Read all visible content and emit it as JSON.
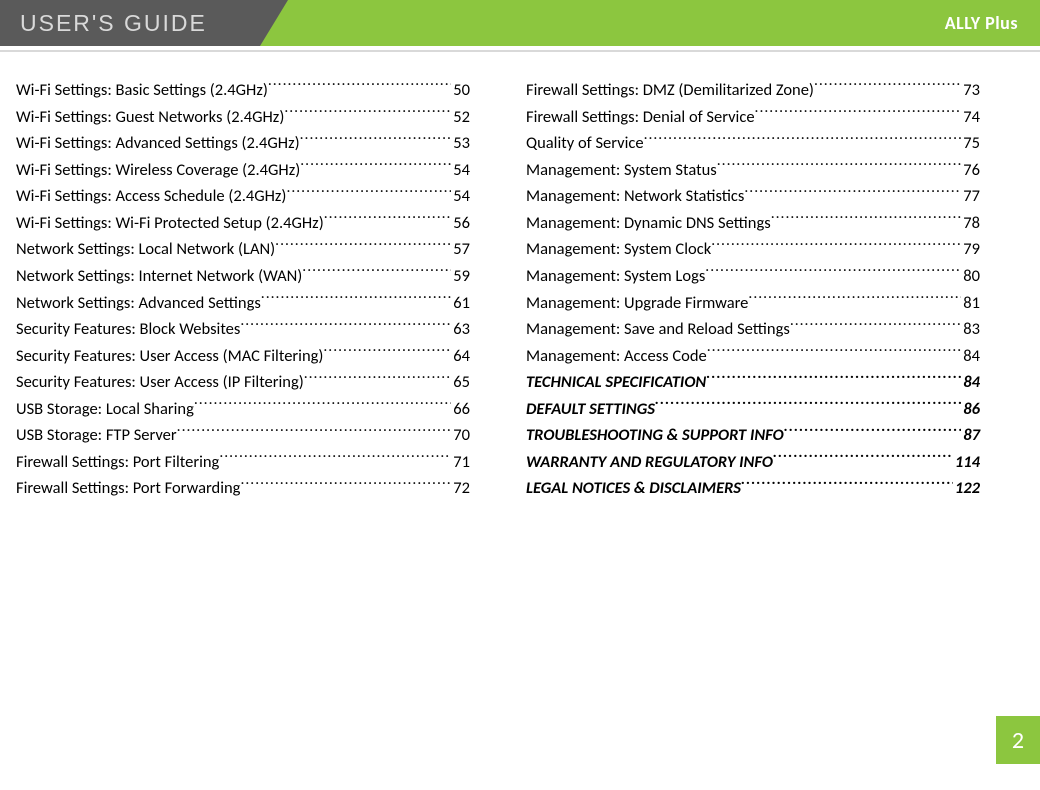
{
  "header": {
    "title": "USER'S GUIDE",
    "product": "ALLY Plus"
  },
  "page_number": "2",
  "toc": {
    "left": [
      {
        "title": "Wi-Fi Settings: Basic Settings (2.4GHz)",
        "page": "50",
        "bold": false
      },
      {
        "title": "Wi-Fi Settings: Guest Networks (2.4GHz)",
        "page": "52",
        "bold": false
      },
      {
        "title": "Wi-Fi Settings: Advanced Settings (2.4GHz)",
        "page": "53",
        "bold": false
      },
      {
        "title": "Wi-Fi Settings: Wireless Coverage (2.4GHz)",
        "page": "54",
        "bold": false
      },
      {
        "title": "Wi-Fi Settings: Access Schedule (2.4GHz)",
        "page": "54",
        "bold": false
      },
      {
        "title": "Wi-Fi Settings: Wi-Fi Protected Setup (2.4GHz)",
        "page": "56",
        "bold": false
      },
      {
        "title": "Network Settings: Local Network (LAN)",
        "page": "57",
        "bold": false
      },
      {
        "title": "Network Settings: Internet Network (WAN)",
        "page": "59",
        "bold": false
      },
      {
        "title": "Network Settings: Advanced Settings",
        "page": "61",
        "bold": false
      },
      {
        "title": "Security Features: Block Websites",
        "page": "63",
        "bold": false
      },
      {
        "title": "Security Features: User Access (MAC Filtering)",
        "page": "64",
        "bold": false
      },
      {
        "title": "Security Features: User Access (IP Filtering)",
        "page": "65",
        "bold": false
      },
      {
        "title": "USB Storage: Local Sharing",
        "page": "66",
        "bold": false
      },
      {
        "title": "USB Storage: FTP Server",
        "page": "70",
        "bold": false
      },
      {
        "title": "Firewall Settings: Port Filtering",
        "page": "71",
        "bold": false
      },
      {
        "title": "Firewall Settings: Port Forwarding",
        "page": "72",
        "bold": false
      }
    ],
    "right": [
      {
        "title": "Firewall Settings: DMZ (Demilitarized Zone)",
        "page": "73",
        "bold": false
      },
      {
        "title": "Firewall Settings: Denial of Service",
        "page": "74",
        "bold": false
      },
      {
        "title": "Quality of Service",
        "page": "75",
        "bold": false
      },
      {
        "title": "Management: System Status",
        "page": "76",
        "bold": false
      },
      {
        "title": "Management: Network Statistics",
        "page": "77",
        "bold": false
      },
      {
        "title": "Management: Dynamic DNS Settings",
        "page": "78",
        "bold": false
      },
      {
        "title": "Management: System Clock",
        "page": "79",
        "bold": false
      },
      {
        "title": "Management: System Logs",
        "page": "80",
        "bold": false
      },
      {
        "title": "Management: Upgrade Firmware",
        "page": "81",
        "bold": false
      },
      {
        "title": "Management: Save and Reload Settings",
        "page": "83",
        "bold": false
      },
      {
        "title": "Management: Access Code",
        "page": "84",
        "bold": false
      },
      {
        "title": "TECHNICAL SPECIFICATION",
        "page": "84",
        "bold": true
      },
      {
        "title": "DEFAULT SETTINGS",
        "page": "86",
        "bold": true
      },
      {
        "title": "TROUBLESHOOTING & SUPPORT INFO",
        "page": "87",
        "bold": true
      },
      {
        "title": "WARRANTY AND REGULATORY INFO",
        "page": "114",
        "bold": true
      },
      {
        "title": "LEGAL NOTICES & DISCLAIMERS",
        "page": "122",
        "bold": true
      }
    ]
  }
}
